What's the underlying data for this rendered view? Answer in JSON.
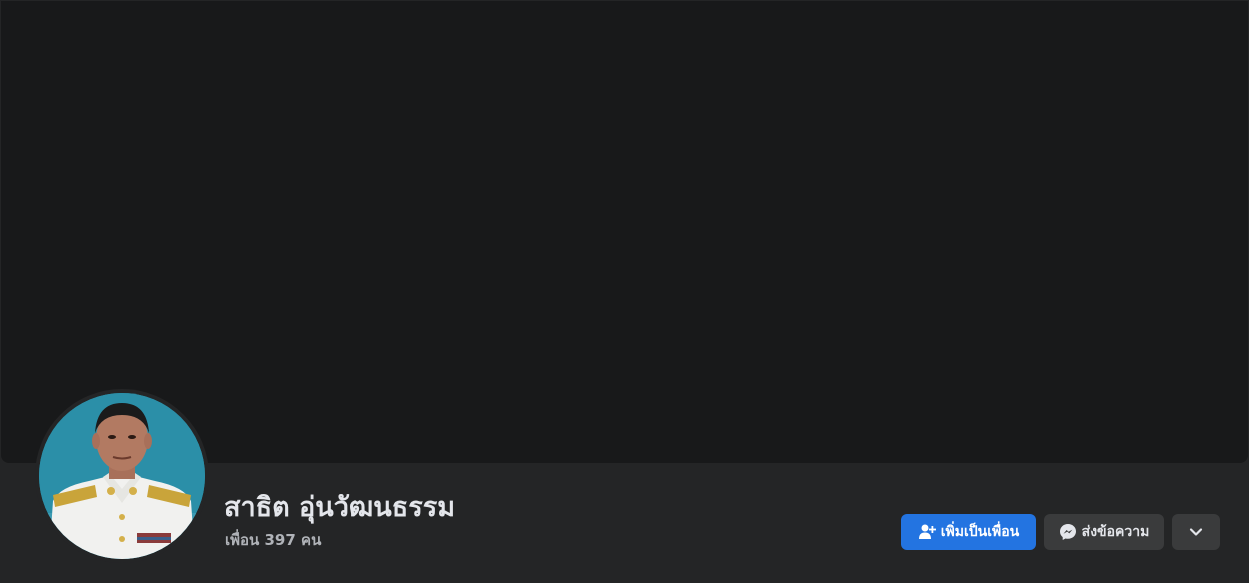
{
  "profile": {
    "name": "สาธิต อุ่นวัฒนธรรม",
    "friends_count": "เพื่อน 397 คน"
  },
  "actions": {
    "add_friend_label": "เพิ่มเป็นเพื่อน",
    "message_label": "ส่งข้อความ"
  },
  "icons": {
    "add_friend": "add-friend-icon",
    "messenger": "messenger-icon",
    "more": "chevron-down-icon"
  },
  "colors": {
    "primary_button": "#2374e1",
    "secondary_button": "#3a3b3c",
    "cover": "#18191a",
    "surface": "#242526"
  }
}
